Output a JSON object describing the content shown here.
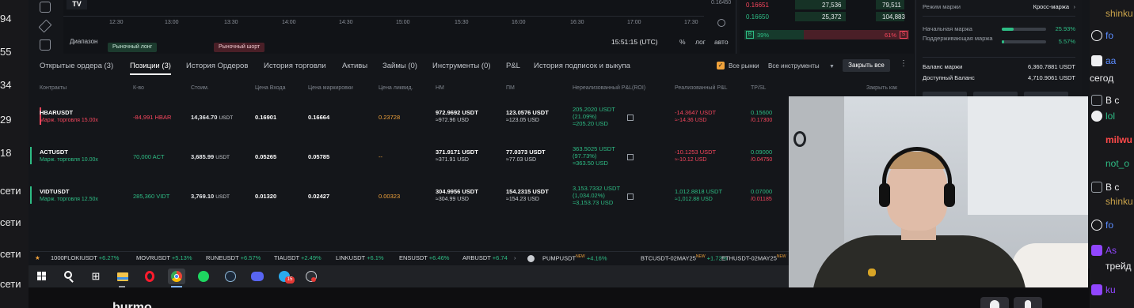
{
  "left_strip": {
    "numbers": [
      "94",
      "55",
      "34",
      "29",
      "18",
      "сети",
      "сети",
      "сети",
      "сети"
    ]
  },
  "chart": {
    "times": [
      "12:30",
      "13:00",
      "13:30",
      "14:00",
      "14:30",
      "15:00",
      "15:30",
      "16:00",
      "16:30",
      "17:00",
      "17:30"
    ],
    "price_tick": "0.16450",
    "range_label": "Диапазон",
    "market_long": "Рыночный лонг",
    "market_short": "Рыночный шорт",
    "clock": "15:51:15 (UTC)",
    "percent": "%",
    "log": "лог",
    "auto": "авто"
  },
  "order_book": {
    "rows": [
      {
        "price": "0.16651",
        "size": "27,536",
        "total": "79,511"
      },
      {
        "price": "0.16650",
        "size": "25,372",
        "total": "104,883"
      }
    ],
    "buy_pct": "39%",
    "sell_pct": "61%",
    "buy_badge": "B",
    "sell_badge": "S"
  },
  "margin_panel": {
    "mode_label": "Режим маржи",
    "mode_value": "Кросс-маржа",
    "initial_label": "Начальная маржа",
    "initial_value": "25.93%",
    "initial_fill": 0.26,
    "maintenance_label": "Поддерживающая маржа",
    "maintenance_value": "5.57%",
    "maintenance_fill": 0.06,
    "balance_label": "Баланс маржи",
    "balance_value": "6,360.7881 USDT",
    "available_label": "Доступный Баланс",
    "available_value": "4,710.9061 USDT"
  },
  "tabs": [
    "Открытые ордера (3)",
    "Позиции (3)",
    "История Ордеров",
    "История торговли",
    "Активы",
    "Займы (0)",
    "Инструменты (0)",
    "P&L",
    "История подписок и выкупа"
  ],
  "filters": {
    "all_markets": "Все рынки",
    "all_instruments": "Все инструменты",
    "close_all": "Закрыть все"
  },
  "columns": [
    "Контракты",
    "К-во",
    "Стоим.",
    "Цена Входа",
    "Цена маркировки",
    "Цена ликвид.",
    "НМ",
    "ПМ",
    "Нереализованный P&L(ROI)",
    "Реализованный P&L",
    "TP/SL",
    "Закрыть как"
  ],
  "positions": [
    {
      "symbol": "HBARUSDT",
      "margin": "Марж. торговля 15.00x",
      "side": "short",
      "qty": "-84,991 HBAR",
      "value": "14,364.70",
      "value_unit": "USDT",
      "entry": "0.16901",
      "mark": "0.16664",
      "liq": "0.23728",
      "im": "972.9692 USDT",
      "im_approx": "≈972.96 USD",
      "mm": "123.0576 USDT",
      "mm_approx": "≈123.05 USD",
      "upnl": "205.2020 USDT",
      "upnl_roi": "(21.09%)",
      "upnl_approx": "≈205.20 USD",
      "rpnl": "-14.3647 USDT",
      "rpnl_approx": "≈-14.36 USD",
      "tp": "0.15600",
      "sl": "/0.17300"
    },
    {
      "symbol": "ACTUSDT",
      "margin": "Марж. торговля 10.00x",
      "side": "long",
      "qty": "70,000 ACT",
      "value": "3,685.99",
      "value_unit": "USDT",
      "entry": "0.05265",
      "mark": "0.05785",
      "liq": "--",
      "im": "371.9171 USDT",
      "im_approx": "≈371.91 USD",
      "mm": "77.0373 USDT",
      "mm_approx": "≈77.03 USD",
      "upnl": "363.5025 USDT",
      "upnl_roi": "(97.73%)",
      "upnl_approx": "≈363.50 USD",
      "rpnl": "-10.1253 USDT",
      "rpnl_approx": "≈-10.12 USD",
      "tp": "0.09000",
      "sl": "/0.04750"
    },
    {
      "symbol": "VIDTUSDT",
      "margin": "Марж. торговля 12.50x",
      "side": "long",
      "qty": "285,360 VIDT",
      "value": "3,769.10",
      "value_unit": "USDT",
      "entry": "0.01320",
      "mark": "0.02427",
      "liq": "0.00323",
      "im": "304.9956 USDT",
      "im_approx": "≈304.99 USD",
      "mm": "154.2315 USDT",
      "mm_approx": "≈154.23 USD",
      "upnl": "3,153.7332 USDT",
      "upnl_roi": "(1,034.02%)",
      "upnl_approx": "≈3,153.73 USD",
      "rpnl": "1,012.8818 USDT",
      "rpnl_approx": "≈1,012.88 USD",
      "tp": "0.07000",
      "sl": "/0.01185"
    }
  ],
  "ticker": [
    {
      "sym": "1000FLOKIUSDT",
      "chg": "+6.27%"
    },
    {
      "sym": "MOVRUSDT",
      "chg": "+5.13%"
    },
    {
      "sym": "RUNEUSDT",
      "chg": "+6.57%"
    },
    {
      "sym": "TIAUSDT",
      "chg": "+2.49%"
    },
    {
      "sym": "LINKUSDT",
      "chg": "+6.1%"
    },
    {
      "sym": "ENSUSDT",
      "chg": "+6.46%"
    },
    {
      "sym": "ARBUSDT",
      "chg": "+6.74"
    },
    {
      "sym": "PUMPUSDT",
      "chg": "+4.16%"
    },
    {
      "sym": "BTCUSDT-02MAY25",
      "chg": "+1.72%"
    },
    {
      "sym": "ETHUSDT-02MAY25",
      "chg": ""
    }
  ],
  "ticker_new": "NEW",
  "taskbar": {
    "badge": "15"
  },
  "stream": {
    "name": "burmo"
  },
  "chat": [
    {
      "text": "shinku",
      "color": "#c9a24a"
    },
    {
      "text": "fo",
      "color": "#5b8cff"
    },
    {
      "text": "aa",
      "color": "#5b8cff"
    },
    {
      "text": "сегод",
      "color": "#efeff1"
    },
    {
      "text": "В с",
      "color": "#efeff1"
    },
    {
      "text": "lol",
      "color": "#2ebd85"
    },
    {
      "text": "milwu",
      "color": "#ff4a4a"
    },
    {
      "text": "not_o",
      "color": "#2ebd85"
    },
    {
      "text": "В с",
      "color": "#efeff1"
    },
    {
      "text": "shinku",
      "color": "#c9a24a"
    },
    {
      "text": "fo",
      "color": "#5b8cff"
    },
    {
      "text": "As",
      "color": "#9146ff"
    },
    {
      "text": "трейд",
      "color": "#efeff1"
    },
    {
      "text": "ku",
      "color": "#9146ff"
    }
  ]
}
